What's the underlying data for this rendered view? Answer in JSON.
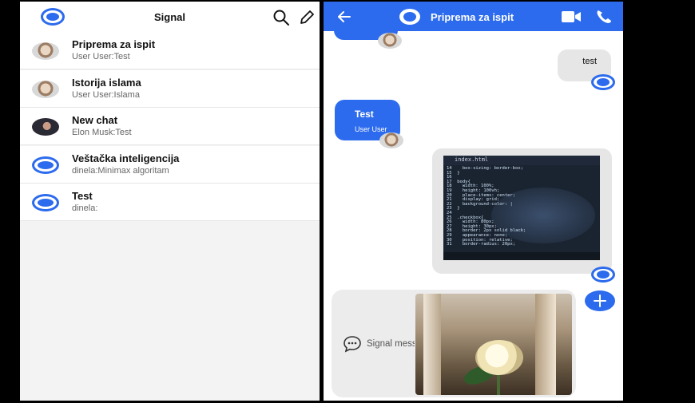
{
  "colors": {
    "accent": "#2c6bed",
    "bubble_incoming": "#2c6bed",
    "bubble_outgoing": "#e6e6e6",
    "list_bg": "#f3f3f3"
  },
  "left": {
    "title": "Signal",
    "icons": {
      "logo": "signal-logo-icon",
      "search": "search-icon",
      "compose": "pencil-icon"
    },
    "chats": [
      {
        "name": "Priprema za ispit",
        "preview": "User User:Test",
        "avatar": "photo"
      },
      {
        "name": "Istorija islama",
        "preview": "User User:Islama",
        "avatar": "photo"
      },
      {
        "name": "New chat",
        "preview": "Elon Musk:Test",
        "avatar": "musk"
      },
      {
        "name": "Veštačka inteligencija",
        "preview": "dinela:Minimax algoritam",
        "avatar": "signal"
      },
      {
        "name": "Test",
        "preview": "dinela:",
        "avatar": "signal"
      }
    ]
  },
  "right": {
    "title": "Priprema za ispit",
    "icons": {
      "back": "arrow-left-icon",
      "video": "video-camera-icon",
      "phone": "phone-icon",
      "add": "plus-icon",
      "message": "chat-bubble-icon"
    },
    "messages": {
      "outgoing_text": "test",
      "incoming_text": "Test",
      "incoming_sender": "User User"
    },
    "code_image": {
      "filename": "index.html",
      "lines": "14    box-sizing: border-box;\n15  }\n16\n17  body{\n18    width: 100%;\n19    height: 100vh;\n20    place-items: center;\n21    display: grid;\n22    background-color: |\n23  }\n24\n25  .checkbox{\n26    width: 80px;\n27    height: 30px;\n28    border: 2px solid black;\n29    appearance: none;\n30    position: relative;\n31    border-radius: 20px;"
    },
    "composer": {
      "placeholder": "Signal message"
    }
  }
}
